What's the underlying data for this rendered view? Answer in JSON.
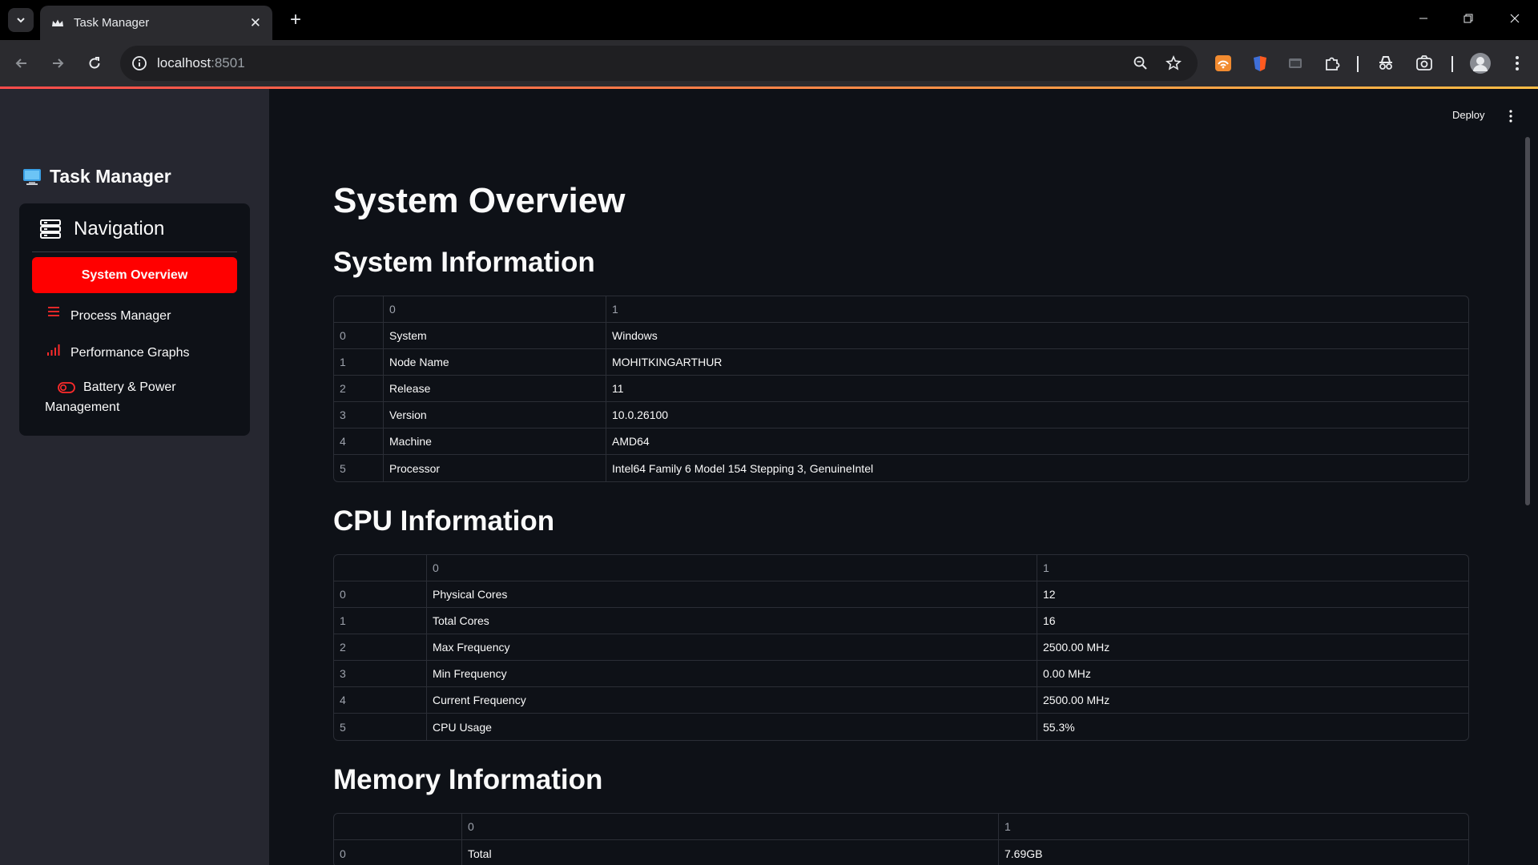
{
  "browser": {
    "tab_title": "Task Manager",
    "url_host": "localhost",
    "url_port": ":8501"
  },
  "sidebar": {
    "brand": "Task Manager",
    "nav_title": "Navigation",
    "items": [
      {
        "label": "System Overview",
        "icon": "home-icon",
        "active": true
      },
      {
        "label": "Process Manager",
        "icon": "list-icon",
        "active": false
      },
      {
        "label": "Performance Graphs",
        "icon": "bar-chart-icon",
        "active": false
      },
      {
        "label": "Battery & Power Management",
        "icon": "toggle-icon",
        "active": false
      }
    ]
  },
  "header": {
    "deploy_label": "Deploy"
  },
  "main": {
    "title": "System Overview",
    "sections": {
      "system": {
        "title": "System Information",
        "columns": [
          "",
          "0",
          "1"
        ],
        "rows": [
          [
            "0",
            "System",
            "Windows"
          ],
          [
            "1",
            "Node Name",
            "MOHITKINGARTHUR"
          ],
          [
            "2",
            "Release",
            "11"
          ],
          [
            "3",
            "Version",
            "10.0.26100"
          ],
          [
            "4",
            "Machine",
            "AMD64"
          ],
          [
            "5",
            "Processor",
            "Intel64 Family 6 Model 154 Stepping 3, GenuineIntel"
          ]
        ]
      },
      "cpu": {
        "title": "CPU Information",
        "columns": [
          "",
          "0",
          "1"
        ],
        "rows": [
          [
            "0",
            "Physical Cores",
            "12"
          ],
          [
            "1",
            "Total Cores",
            "16"
          ],
          [
            "2",
            "Max Frequency",
            "2500.00 MHz"
          ],
          [
            "3",
            "Min Frequency",
            "0.00 MHz"
          ],
          [
            "4",
            "Current Frequency",
            "2500.00 MHz"
          ],
          [
            "5",
            "CPU Usage",
            "55.3%"
          ]
        ]
      },
      "memory": {
        "title": "Memory Information",
        "columns": [
          "",
          "0",
          "1"
        ],
        "rows": [
          [
            "0",
            "Total",
            "7.69GB"
          ]
        ]
      }
    }
  },
  "colors": {
    "accent": "#ff0000",
    "background": "#0e1117",
    "sidebar": "#262730"
  }
}
